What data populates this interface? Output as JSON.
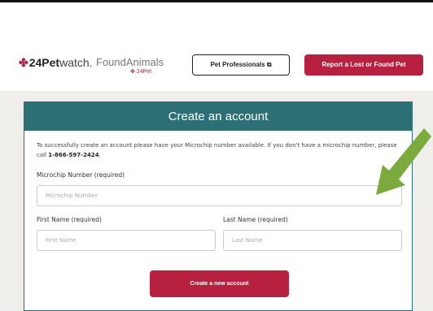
{
  "header": {
    "logo_24_paw": "✤",
    "logo_24_bold": "24Pet",
    "logo_24_light": "watch.",
    "logo_foundanimals": "FoundAnimals",
    "logo_foundanimals_sub": "✤ 24Pet",
    "pet_professionals_label": "Pet Professionals ⧉",
    "report_label": "Report a Lost or Found Pet"
  },
  "form": {
    "title": "Create an account",
    "intro_text": "To successfully create an account please have your Microchip number available. If you don't have a microchip number, please call ",
    "phone": "1-866-597-2424",
    "intro_end": ".",
    "microchip_label": "Microchip Number (required)",
    "microchip_placeholder": "Microchip Number",
    "first_name_label": "First Name (required)",
    "first_name_placeholder": "First Name",
    "last_name_label": "Last Name (required)",
    "last_name_placeholder": "Last Name",
    "submit_label": "Create a new account"
  },
  "colors": {
    "brand_red": "#b8203f",
    "header_teal": "#2c7075",
    "arrow_green": "#7aab3c",
    "page_band": "#f0eeea"
  },
  "icons": [
    "paw-icon",
    "external-link-icon",
    "green-arrow-icon"
  ]
}
